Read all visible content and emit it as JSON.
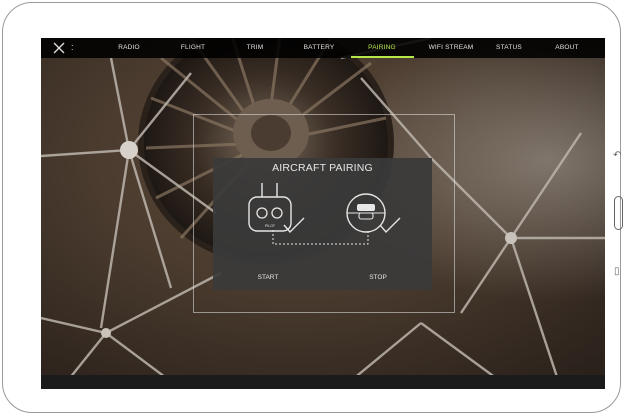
{
  "nav": {
    "tabs": [
      {
        "label": "RADIO",
        "active": false
      },
      {
        "label": "FLIGHT",
        "active": false
      },
      {
        "label": "TRIM",
        "active": false
      },
      {
        "label": "BATTERY",
        "active": false
      },
      {
        "label": "PAIRING",
        "active": true
      },
      {
        "label": "WIFI STREAM",
        "active": false
      },
      {
        "label": "STATUS",
        "active": false
      },
      {
        "label": "ABOUT",
        "active": false
      }
    ],
    "close_icon": "close-icon",
    "more_icon": "more-icon",
    "dots": ":"
  },
  "dialog": {
    "title": "AIRCRAFT PAIRING",
    "remote_label": "PILOT",
    "start_label": "START",
    "stop_label": "STOP"
  },
  "colors": {
    "accent": "#b7e84a",
    "navbar": "#000000",
    "dialog": "#3a3a3a"
  },
  "device": {
    "back_icon": "back-icon",
    "home_button": "home-button",
    "recent_icon": "recent-apps-icon"
  }
}
